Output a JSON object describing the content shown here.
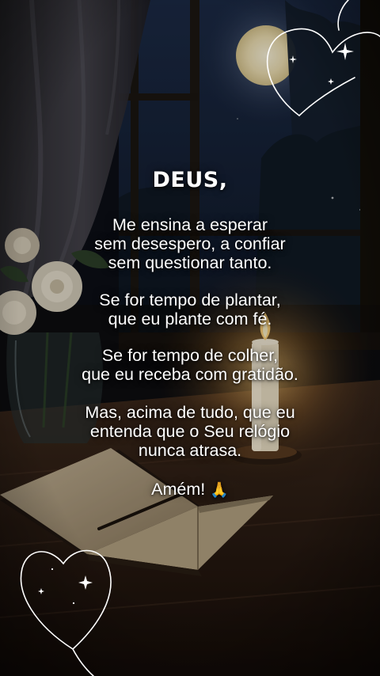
{
  "title": "DEUS,",
  "stanzas": [
    {
      "lines": [
        "Me ensina a esperar",
        "sem desespero, a confiar",
        "sem questionar tanto."
      ]
    },
    {
      "lines": [
        "Se for tempo de plantar,",
        "que eu plante com fé."
      ]
    },
    {
      "lines": [
        "Se for tempo de colher,",
        "que eu receba com gratidão."
      ]
    },
    {
      "lines": [
        "Mas, acima de tudo, que eu",
        "entenda que o Seu relógio",
        "nunca atrasa."
      ]
    }
  ],
  "closing": {
    "text": "Amém!",
    "emoji": "🙏",
    "emoji_name": "praying-hands-icon"
  },
  "colors": {
    "text": "#ffffff",
    "sky": "#1b2a45",
    "moon": "#f2e6c2",
    "candle_flame": "#ffd27a",
    "wood": "#3a2417"
  }
}
